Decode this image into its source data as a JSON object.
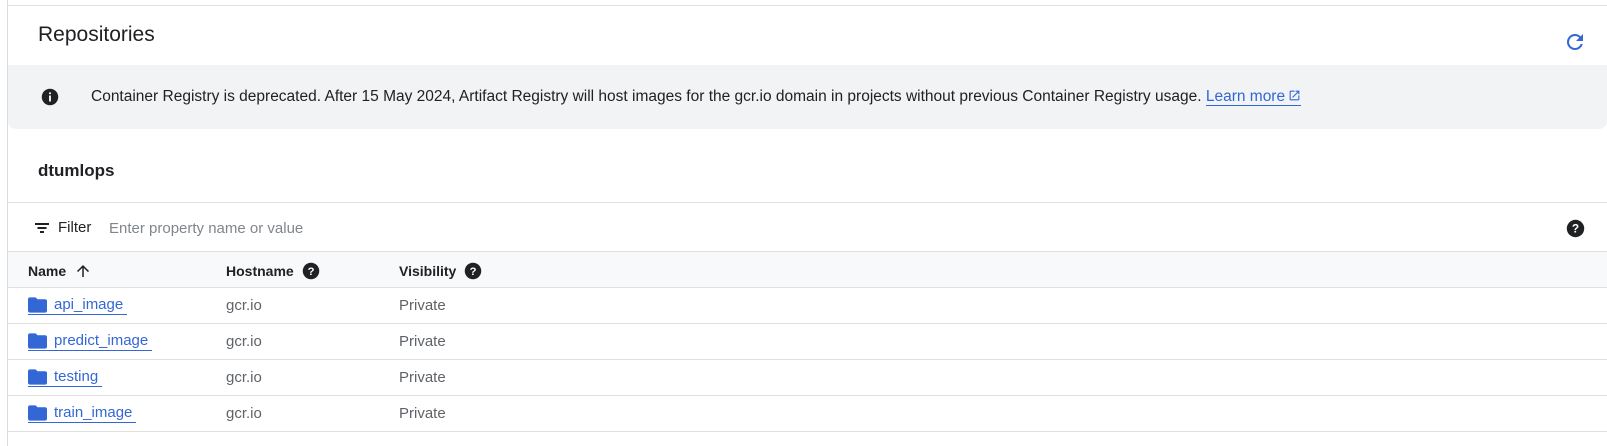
{
  "header": {
    "title": "Repositories",
    "refresh_icon": "refresh-icon"
  },
  "banner": {
    "icon": "info-icon",
    "message": "Container Registry is deprecated. After 15 May 2024, Artifact Registry will host images for the gcr.io domain in projects without previous Container Registry usage.",
    "link_label": "Learn more",
    "link_icon": "external-link-icon"
  },
  "project": {
    "name": "dtumlops"
  },
  "filter": {
    "label": "Filter",
    "placeholder": "Enter property name or value",
    "value": ""
  },
  "table": {
    "columns": [
      {
        "label": "Name",
        "sort": "ascending"
      },
      {
        "label": "Hostname",
        "help": true
      },
      {
        "label": "Visibility",
        "help": true
      }
    ],
    "rows": [
      {
        "name": "api_image",
        "hostname": "gcr.io",
        "visibility": "Private"
      },
      {
        "name": "predict_image",
        "hostname": "gcr.io",
        "visibility": "Private"
      },
      {
        "name": "testing",
        "hostname": "gcr.io",
        "visibility": "Private"
      },
      {
        "name": "train_image",
        "hostname": "gcr.io",
        "visibility": "Private"
      }
    ]
  },
  "colors": {
    "link": "#3367d6",
    "banner_bg": "#f1f3f4",
    "folder": "#3367d6"
  }
}
